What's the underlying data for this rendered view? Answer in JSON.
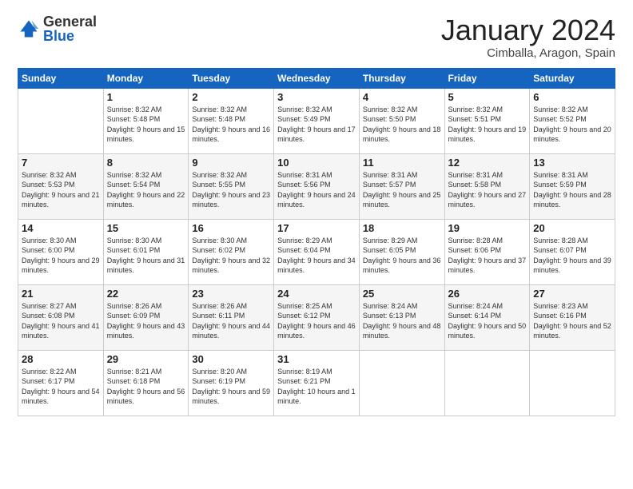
{
  "logo": {
    "general": "General",
    "blue": "Blue"
  },
  "header": {
    "month": "January 2024",
    "location": "Cimballa, Aragon, Spain"
  },
  "days_of_week": [
    "Sunday",
    "Monday",
    "Tuesday",
    "Wednesday",
    "Thursday",
    "Friday",
    "Saturday"
  ],
  "weeks": [
    [
      {
        "day": "",
        "sunrise": "",
        "sunset": "",
        "daylight": ""
      },
      {
        "day": "1",
        "sunrise": "Sunrise: 8:32 AM",
        "sunset": "Sunset: 5:48 PM",
        "daylight": "Daylight: 9 hours and 15 minutes."
      },
      {
        "day": "2",
        "sunrise": "Sunrise: 8:32 AM",
        "sunset": "Sunset: 5:48 PM",
        "daylight": "Daylight: 9 hours and 16 minutes."
      },
      {
        "day": "3",
        "sunrise": "Sunrise: 8:32 AM",
        "sunset": "Sunset: 5:49 PM",
        "daylight": "Daylight: 9 hours and 17 minutes."
      },
      {
        "day": "4",
        "sunrise": "Sunrise: 8:32 AM",
        "sunset": "Sunset: 5:50 PM",
        "daylight": "Daylight: 9 hours and 18 minutes."
      },
      {
        "day": "5",
        "sunrise": "Sunrise: 8:32 AM",
        "sunset": "Sunset: 5:51 PM",
        "daylight": "Daylight: 9 hours and 19 minutes."
      },
      {
        "day": "6",
        "sunrise": "Sunrise: 8:32 AM",
        "sunset": "Sunset: 5:52 PM",
        "daylight": "Daylight: 9 hours and 20 minutes."
      }
    ],
    [
      {
        "day": "7",
        "sunrise": "Sunrise: 8:32 AM",
        "sunset": "Sunset: 5:53 PM",
        "daylight": "Daylight: 9 hours and 21 minutes."
      },
      {
        "day": "8",
        "sunrise": "Sunrise: 8:32 AM",
        "sunset": "Sunset: 5:54 PM",
        "daylight": "Daylight: 9 hours and 22 minutes."
      },
      {
        "day": "9",
        "sunrise": "Sunrise: 8:32 AM",
        "sunset": "Sunset: 5:55 PM",
        "daylight": "Daylight: 9 hours and 23 minutes."
      },
      {
        "day": "10",
        "sunrise": "Sunrise: 8:31 AM",
        "sunset": "Sunset: 5:56 PM",
        "daylight": "Daylight: 9 hours and 24 minutes."
      },
      {
        "day": "11",
        "sunrise": "Sunrise: 8:31 AM",
        "sunset": "Sunset: 5:57 PM",
        "daylight": "Daylight: 9 hours and 25 minutes."
      },
      {
        "day": "12",
        "sunrise": "Sunrise: 8:31 AM",
        "sunset": "Sunset: 5:58 PM",
        "daylight": "Daylight: 9 hours and 27 minutes."
      },
      {
        "day": "13",
        "sunrise": "Sunrise: 8:31 AM",
        "sunset": "Sunset: 5:59 PM",
        "daylight": "Daylight: 9 hours and 28 minutes."
      }
    ],
    [
      {
        "day": "14",
        "sunrise": "Sunrise: 8:30 AM",
        "sunset": "Sunset: 6:00 PM",
        "daylight": "Daylight: 9 hours and 29 minutes."
      },
      {
        "day": "15",
        "sunrise": "Sunrise: 8:30 AM",
        "sunset": "Sunset: 6:01 PM",
        "daylight": "Daylight: 9 hours and 31 minutes."
      },
      {
        "day": "16",
        "sunrise": "Sunrise: 8:30 AM",
        "sunset": "Sunset: 6:02 PM",
        "daylight": "Daylight: 9 hours and 32 minutes."
      },
      {
        "day": "17",
        "sunrise": "Sunrise: 8:29 AM",
        "sunset": "Sunset: 6:04 PM",
        "daylight": "Daylight: 9 hours and 34 minutes."
      },
      {
        "day": "18",
        "sunrise": "Sunrise: 8:29 AM",
        "sunset": "Sunset: 6:05 PM",
        "daylight": "Daylight: 9 hours and 36 minutes."
      },
      {
        "day": "19",
        "sunrise": "Sunrise: 8:28 AM",
        "sunset": "Sunset: 6:06 PM",
        "daylight": "Daylight: 9 hours and 37 minutes."
      },
      {
        "day": "20",
        "sunrise": "Sunrise: 8:28 AM",
        "sunset": "Sunset: 6:07 PM",
        "daylight": "Daylight: 9 hours and 39 minutes."
      }
    ],
    [
      {
        "day": "21",
        "sunrise": "Sunrise: 8:27 AM",
        "sunset": "Sunset: 6:08 PM",
        "daylight": "Daylight: 9 hours and 41 minutes."
      },
      {
        "day": "22",
        "sunrise": "Sunrise: 8:26 AM",
        "sunset": "Sunset: 6:09 PM",
        "daylight": "Daylight: 9 hours and 43 minutes."
      },
      {
        "day": "23",
        "sunrise": "Sunrise: 8:26 AM",
        "sunset": "Sunset: 6:11 PM",
        "daylight": "Daylight: 9 hours and 44 minutes."
      },
      {
        "day": "24",
        "sunrise": "Sunrise: 8:25 AM",
        "sunset": "Sunset: 6:12 PM",
        "daylight": "Daylight: 9 hours and 46 minutes."
      },
      {
        "day": "25",
        "sunrise": "Sunrise: 8:24 AM",
        "sunset": "Sunset: 6:13 PM",
        "daylight": "Daylight: 9 hours and 48 minutes."
      },
      {
        "day": "26",
        "sunrise": "Sunrise: 8:24 AM",
        "sunset": "Sunset: 6:14 PM",
        "daylight": "Daylight: 9 hours and 50 minutes."
      },
      {
        "day": "27",
        "sunrise": "Sunrise: 8:23 AM",
        "sunset": "Sunset: 6:16 PM",
        "daylight": "Daylight: 9 hours and 52 minutes."
      }
    ],
    [
      {
        "day": "28",
        "sunrise": "Sunrise: 8:22 AM",
        "sunset": "Sunset: 6:17 PM",
        "daylight": "Daylight: 9 hours and 54 minutes."
      },
      {
        "day": "29",
        "sunrise": "Sunrise: 8:21 AM",
        "sunset": "Sunset: 6:18 PM",
        "daylight": "Daylight: 9 hours and 56 minutes."
      },
      {
        "day": "30",
        "sunrise": "Sunrise: 8:20 AM",
        "sunset": "Sunset: 6:19 PM",
        "daylight": "Daylight: 9 hours and 59 minutes."
      },
      {
        "day": "31",
        "sunrise": "Sunrise: 8:19 AM",
        "sunset": "Sunset: 6:21 PM",
        "daylight": "Daylight: 10 hours and 1 minute."
      },
      {
        "day": "",
        "sunrise": "",
        "sunset": "",
        "daylight": ""
      },
      {
        "day": "",
        "sunrise": "",
        "sunset": "",
        "daylight": ""
      },
      {
        "day": "",
        "sunrise": "",
        "sunset": "",
        "daylight": ""
      }
    ]
  ]
}
